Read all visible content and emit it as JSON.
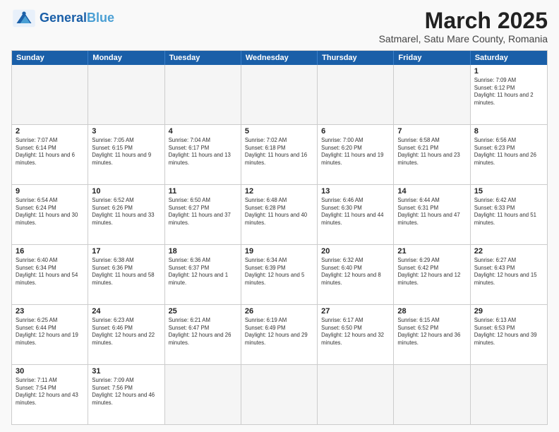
{
  "header": {
    "logo_general": "General",
    "logo_blue": "Blue",
    "month_title": "March 2025",
    "location": "Satmarel, Satu Mare County, Romania"
  },
  "days_of_week": [
    "Sunday",
    "Monday",
    "Tuesday",
    "Wednesday",
    "Thursday",
    "Friday",
    "Saturday"
  ],
  "weeks": [
    [
      {
        "day": "",
        "info": ""
      },
      {
        "day": "",
        "info": ""
      },
      {
        "day": "",
        "info": ""
      },
      {
        "day": "",
        "info": ""
      },
      {
        "day": "",
        "info": ""
      },
      {
        "day": "",
        "info": ""
      },
      {
        "day": "1",
        "info": "Sunrise: 7:09 AM\nSunset: 6:12 PM\nDaylight: 11 hours and 2 minutes."
      }
    ],
    [
      {
        "day": "2",
        "info": "Sunrise: 7:07 AM\nSunset: 6:14 PM\nDaylight: 11 hours and 6 minutes."
      },
      {
        "day": "3",
        "info": "Sunrise: 7:05 AM\nSunset: 6:15 PM\nDaylight: 11 hours and 9 minutes."
      },
      {
        "day": "4",
        "info": "Sunrise: 7:04 AM\nSunset: 6:17 PM\nDaylight: 11 hours and 13 minutes."
      },
      {
        "day": "5",
        "info": "Sunrise: 7:02 AM\nSunset: 6:18 PM\nDaylight: 11 hours and 16 minutes."
      },
      {
        "day": "6",
        "info": "Sunrise: 7:00 AM\nSunset: 6:20 PM\nDaylight: 11 hours and 19 minutes."
      },
      {
        "day": "7",
        "info": "Sunrise: 6:58 AM\nSunset: 6:21 PM\nDaylight: 11 hours and 23 minutes."
      },
      {
        "day": "8",
        "info": "Sunrise: 6:56 AM\nSunset: 6:23 PM\nDaylight: 11 hours and 26 minutes."
      }
    ],
    [
      {
        "day": "9",
        "info": "Sunrise: 6:54 AM\nSunset: 6:24 PM\nDaylight: 11 hours and 30 minutes."
      },
      {
        "day": "10",
        "info": "Sunrise: 6:52 AM\nSunset: 6:26 PM\nDaylight: 11 hours and 33 minutes."
      },
      {
        "day": "11",
        "info": "Sunrise: 6:50 AM\nSunset: 6:27 PM\nDaylight: 11 hours and 37 minutes."
      },
      {
        "day": "12",
        "info": "Sunrise: 6:48 AM\nSunset: 6:28 PM\nDaylight: 11 hours and 40 minutes."
      },
      {
        "day": "13",
        "info": "Sunrise: 6:46 AM\nSunset: 6:30 PM\nDaylight: 11 hours and 44 minutes."
      },
      {
        "day": "14",
        "info": "Sunrise: 6:44 AM\nSunset: 6:31 PM\nDaylight: 11 hours and 47 minutes."
      },
      {
        "day": "15",
        "info": "Sunrise: 6:42 AM\nSunset: 6:33 PM\nDaylight: 11 hours and 51 minutes."
      }
    ],
    [
      {
        "day": "16",
        "info": "Sunrise: 6:40 AM\nSunset: 6:34 PM\nDaylight: 11 hours and 54 minutes."
      },
      {
        "day": "17",
        "info": "Sunrise: 6:38 AM\nSunset: 6:36 PM\nDaylight: 11 hours and 58 minutes."
      },
      {
        "day": "18",
        "info": "Sunrise: 6:36 AM\nSunset: 6:37 PM\nDaylight: 12 hours and 1 minute."
      },
      {
        "day": "19",
        "info": "Sunrise: 6:34 AM\nSunset: 6:39 PM\nDaylight: 12 hours and 5 minutes."
      },
      {
        "day": "20",
        "info": "Sunrise: 6:32 AM\nSunset: 6:40 PM\nDaylight: 12 hours and 8 minutes."
      },
      {
        "day": "21",
        "info": "Sunrise: 6:29 AM\nSunset: 6:42 PM\nDaylight: 12 hours and 12 minutes."
      },
      {
        "day": "22",
        "info": "Sunrise: 6:27 AM\nSunset: 6:43 PM\nDaylight: 12 hours and 15 minutes."
      }
    ],
    [
      {
        "day": "23",
        "info": "Sunrise: 6:25 AM\nSunset: 6:44 PM\nDaylight: 12 hours and 19 minutes."
      },
      {
        "day": "24",
        "info": "Sunrise: 6:23 AM\nSunset: 6:46 PM\nDaylight: 12 hours and 22 minutes."
      },
      {
        "day": "25",
        "info": "Sunrise: 6:21 AM\nSunset: 6:47 PM\nDaylight: 12 hours and 26 minutes."
      },
      {
        "day": "26",
        "info": "Sunrise: 6:19 AM\nSunset: 6:49 PM\nDaylight: 12 hours and 29 minutes."
      },
      {
        "day": "27",
        "info": "Sunrise: 6:17 AM\nSunset: 6:50 PM\nDaylight: 12 hours and 32 minutes."
      },
      {
        "day": "28",
        "info": "Sunrise: 6:15 AM\nSunset: 6:52 PM\nDaylight: 12 hours and 36 minutes."
      },
      {
        "day": "29",
        "info": "Sunrise: 6:13 AM\nSunset: 6:53 PM\nDaylight: 12 hours and 39 minutes."
      }
    ],
    [
      {
        "day": "30",
        "info": "Sunrise: 7:11 AM\nSunset: 7:54 PM\nDaylight: 12 hours and 43 minutes."
      },
      {
        "day": "31",
        "info": "Sunrise: 7:09 AM\nSunset: 7:56 PM\nDaylight: 12 hours and 46 minutes."
      },
      {
        "day": "",
        "info": ""
      },
      {
        "day": "",
        "info": ""
      },
      {
        "day": "",
        "info": ""
      },
      {
        "day": "",
        "info": ""
      },
      {
        "day": "",
        "info": ""
      }
    ]
  ]
}
